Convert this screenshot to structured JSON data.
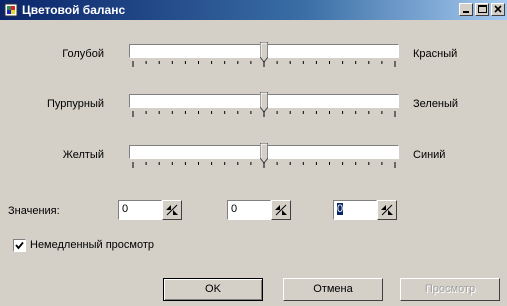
{
  "window": {
    "title": "Цветовой баланс"
  },
  "sliders": [
    {
      "left_label": "Голубой",
      "right_label": "Красный",
      "value": 0
    },
    {
      "left_label": "Пурпурный",
      "right_label": "Зеленый",
      "value": 0
    },
    {
      "left_label": "Желтый",
      "right_label": "Синий",
      "value": 0
    }
  ],
  "values": {
    "label": "Значения:",
    "fields": [
      "0",
      "0",
      "0"
    ]
  },
  "preview_checkbox": {
    "label": "Немедленный просмотр",
    "checked": true
  },
  "buttons": {
    "ok": "OK",
    "cancel": "Отмена",
    "preview": "Просмотр"
  },
  "icons": {
    "app": "color-balance-icon",
    "minimize": "minimize-icon",
    "maximize": "maximize-icon",
    "close": "close-icon",
    "spin": "spin-arrows-icon",
    "check": "checkmark-icon"
  },
  "colors": {
    "title_start": "#0a246a",
    "title_end": "#a6caf0",
    "face": "#d4d0c8",
    "selection": "#0a246a"
  }
}
